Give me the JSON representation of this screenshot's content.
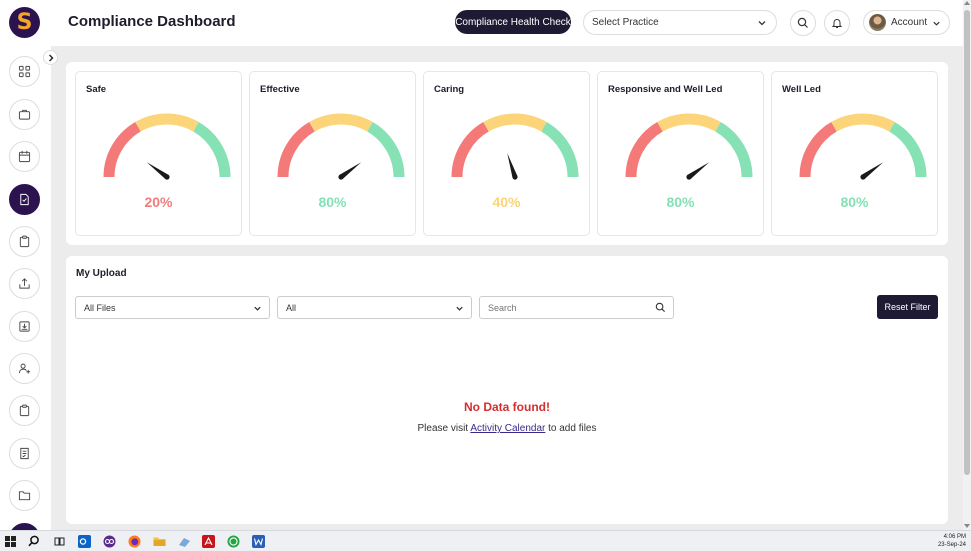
{
  "header": {
    "logo_letter": "S",
    "title": "Compliance Dashboard",
    "health_check_label": "Compliance Health Check",
    "practice_select": "Select Practice",
    "account_label": "Account"
  },
  "sidebar": {
    "items": [
      {
        "name": "grid-icon"
      },
      {
        "name": "briefcase-icon"
      },
      {
        "name": "calendar-icon"
      },
      {
        "name": "document-icon",
        "active": true
      },
      {
        "name": "clipboard-icon"
      },
      {
        "name": "upload-icon"
      },
      {
        "name": "inbox-icon"
      },
      {
        "name": "user-add-icon"
      },
      {
        "name": "clipboard-icon"
      },
      {
        "name": "checklist-icon"
      },
      {
        "name": "folder-icon"
      }
    ]
  },
  "gauges": [
    {
      "title": "Safe",
      "value": 20,
      "label": "20%",
      "color": "#f07c7c"
    },
    {
      "title": "Effective",
      "value": 80,
      "label": "80%",
      "color": "#86e0b6"
    },
    {
      "title": "Caring",
      "value": 40,
      "label": "40%",
      "color": "#fbd478"
    },
    {
      "title": "Responsive and Well Led",
      "value": 80,
      "label": "80%",
      "color": "#86e0b6"
    },
    {
      "title": "Well Led",
      "value": 80,
      "label": "80%",
      "color": "#86e0b6"
    }
  ],
  "gauge_colors": {
    "low": "#f47a7a",
    "mid": "#fcd47a",
    "high": "#86e2b4",
    "needle": "#1a1a1a"
  },
  "upload": {
    "title": "My Upload",
    "file_filter": "All Files",
    "type_filter": "All",
    "search_placeholder": "Search",
    "reset_label": "Reset Filter",
    "no_data": "No Data found!",
    "visit_prefix": "Please visit",
    "visit_link": "Activity Calendar",
    "visit_suffix": "to add files"
  },
  "taskbar": {
    "time": "4:06 PM",
    "date": "23-Sep-24"
  },
  "colors": {
    "brand": "#2d1250",
    "dark_button": "#1f1a33",
    "accent": "#f5a623",
    "error": "#d32f2f"
  }
}
